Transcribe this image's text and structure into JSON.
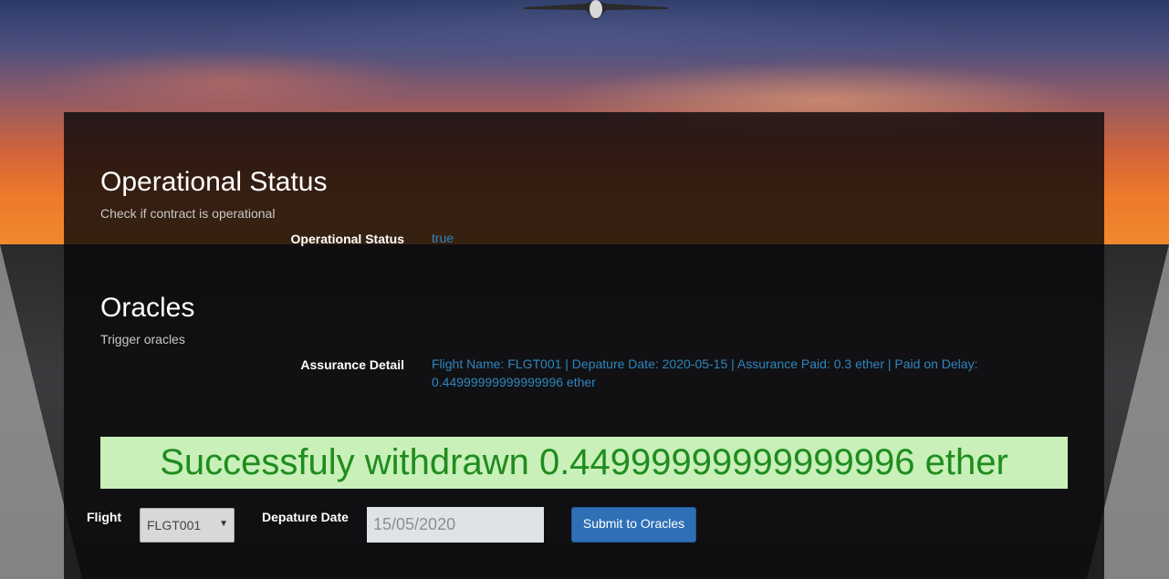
{
  "operational": {
    "title": "Operational Status",
    "subtitle": "Check if contract is operational",
    "label": "Operational Status",
    "value": "true"
  },
  "oracles": {
    "title": "Oracles",
    "subtitle": "Trigger oracles",
    "label": "Assurance Detail",
    "detail_line1": "Flight Name: FLGT001 | Depature Date: 2020-05-15 | Assurance Paid: 0.3 ether | Paid on Delay:",
    "detail_line2": "0.44999999999999996 ether"
  },
  "success_message": "Successfuly withdrawn 0.44999999999999996 ether",
  "form": {
    "flight_label": "Flight",
    "flight_selected": "FLGT001",
    "date_label": "Depature Date",
    "date_value": "15/05/2020",
    "submit_label": "Submit to Oracles"
  },
  "colors": {
    "accent_link": "#2f86bd",
    "success_bg": "#c8f0b8",
    "success_text": "#1f8c1f",
    "button": "#2e6fb6"
  }
}
